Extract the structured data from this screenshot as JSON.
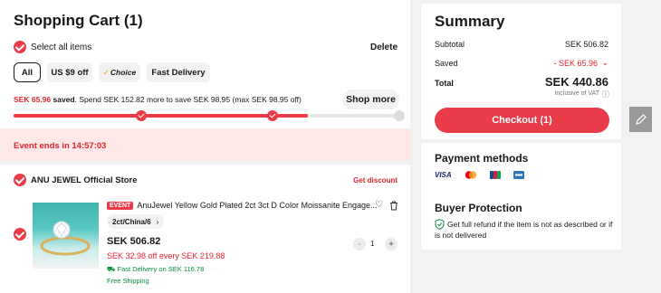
{
  "cart": {
    "title": "Shopping Cart (1)",
    "select_all": "Select all items",
    "delete": "Delete",
    "chips": [
      "All",
      "US $9 off",
      "Choice",
      "Fast Delivery"
    ],
    "promo_saved_amount": "SEK 65.96",
    "promo_saved_word": "saved",
    "promo_rest": ". Spend SEK 152.82 more to save SEK 98.95 (max SEK 98.95 off)",
    "shop_more": "Shop more",
    "progress_fraction": 0.76
  },
  "event": {
    "text": "Event ends in 14:57:03"
  },
  "store": {
    "name": "ANU JEWEL Official Store",
    "get_discount": "Get discount",
    "product": {
      "badge": "EVENT",
      "title": "AnuJewel Yellow Gold Plated 2ct 3ct D Color Moissanite Engage...",
      "variant": "2ct/China/6",
      "price": "SEK 506.82",
      "discount": "SEK 32.98 off every SEK 219.88",
      "fast_delivery": "Fast Delivery on SEK 116.78",
      "free_shipping": "Free Shipping",
      "quantity": "1",
      "minus": "-",
      "plus": "+"
    }
  },
  "summary": {
    "title": "Summary",
    "subtotal_label": "Subtotal",
    "subtotal_value": "SEK 506.82",
    "saved_label": "Saved",
    "saved_value": "- SEK 65.96",
    "total_label": "Total",
    "total_value": "SEK 440.86",
    "vat": "Inclusive of VAT",
    "checkout": "Checkout (1)"
  },
  "payments": {
    "title": "Payment methods",
    "visa": "VISA",
    "buyer_title": "Buyer Protection",
    "buyer_text": "Get full refund if the item is not as described or if is not delivered"
  },
  "colors": {
    "accent": "#ea3b48",
    "event_bg": "#fde7e7",
    "green": "#0a8f3a"
  }
}
